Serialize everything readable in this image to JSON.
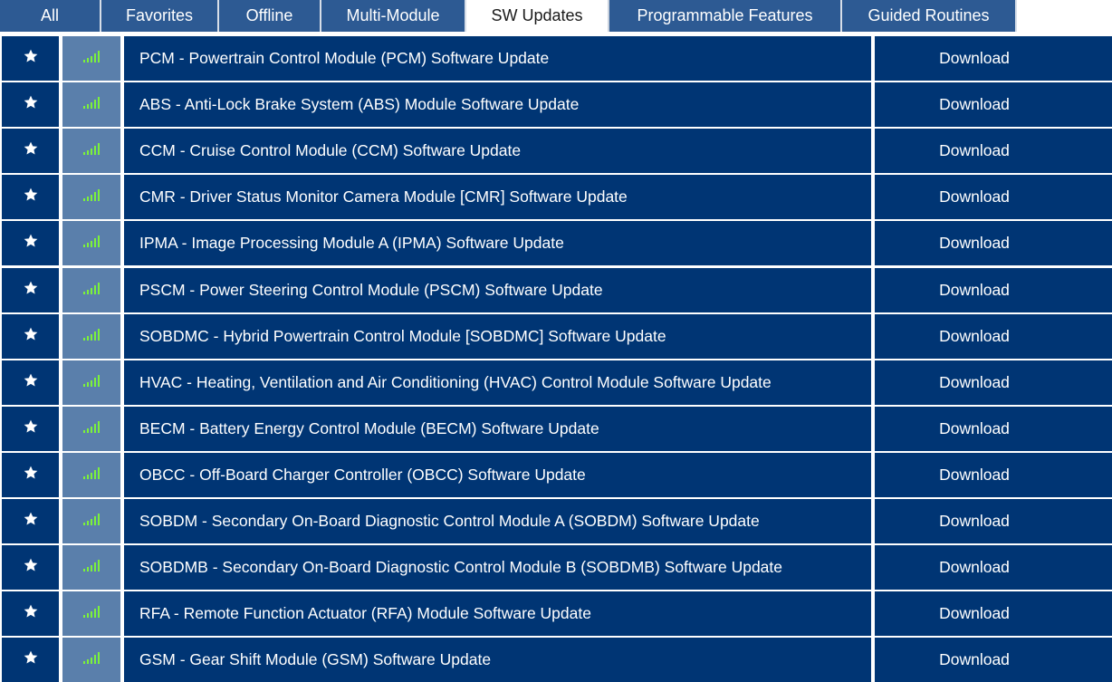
{
  "tabs": [
    {
      "label": "All",
      "active": false
    },
    {
      "label": "Favorites",
      "active": false
    },
    {
      "label": "Offline",
      "active": false
    },
    {
      "label": "Multi-Module",
      "active": false
    },
    {
      "label": "SW Updates",
      "active": true
    },
    {
      "label": "Programmable Features",
      "active": false
    },
    {
      "label": "Guided Routines",
      "active": false
    }
  ],
  "rows": [
    {
      "name": "PCM - Powertrain Control Module (PCM) Software Update",
      "action": "Download"
    },
    {
      "name": "ABS - Anti-Lock Brake System (ABS) Module Software Update",
      "action": "Download"
    },
    {
      "name": "CCM - Cruise Control Module (CCM) Software Update",
      "action": "Download"
    },
    {
      "name": "CMR - Driver Status Monitor Camera Module [CMR] Software Update",
      "action": "Download"
    },
    {
      "name": "IPMA - Image Processing Module A (IPMA) Software Update",
      "action": "Download"
    },
    {
      "name": "PSCM - Power Steering Control Module (PSCM) Software Update",
      "action": "Download"
    },
    {
      "name": "SOBDMC - Hybrid Powertrain Control Module [SOBDMC] Software Update",
      "action": "Download"
    },
    {
      "name": "HVAC - Heating, Ventilation and Air Conditioning (HVAC) Control Module Software Update",
      "action": "Download"
    },
    {
      "name": "BECM - Battery Energy Control Module (BECM) Software Update",
      "action": "Download"
    },
    {
      "name": "OBCC - Off-Board Charger Controller (OBCC) Software Update",
      "action": "Download"
    },
    {
      "name": "SOBDM - Secondary On-Board Diagnostic Control Module A (SOBDM) Software Update",
      "action": "Download"
    },
    {
      "name": "SOBDMB - Secondary On-Board Diagnostic Control Module B (SOBDMB) Software Update",
      "action": "Download"
    },
    {
      "name": "RFA - Remote Function Actuator (RFA) Module Software Update",
      "action": "Download"
    },
    {
      "name": "GSM - Gear Shift Module (GSM) Software Update",
      "action": "Download"
    }
  ],
  "icons": {
    "favorite": "star-icon",
    "signal": "signal-strength-icon"
  },
  "colors": {
    "row_bg": "#003574",
    "signal_cell_bg": "#5a7fab",
    "tab_bg": "#2d5a93",
    "signal_bars": "#7cf23a"
  }
}
